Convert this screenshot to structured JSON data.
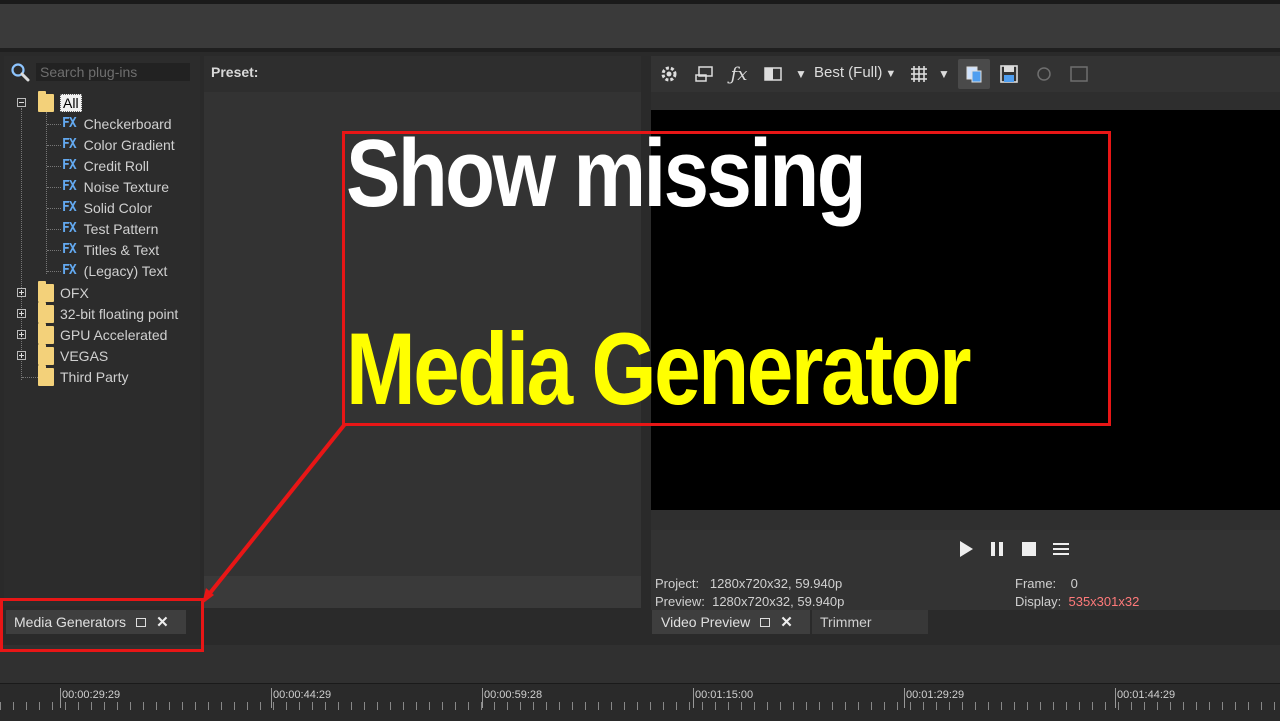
{
  "search": {
    "placeholder": "Search plug-ins"
  },
  "preset": {
    "label": "Preset:"
  },
  "tree": {
    "root": {
      "label": "All"
    },
    "fx_items": [
      {
        "label": "Checkerboard"
      },
      {
        "label": "Color Gradient"
      },
      {
        "label": "Credit Roll"
      },
      {
        "label": "Noise Texture"
      },
      {
        "label": "Solid Color"
      },
      {
        "label": "Test Pattern"
      },
      {
        "label": "Titles & Text"
      },
      {
        "label": "(Legacy) Text"
      }
    ],
    "folders": [
      {
        "label": "OFX"
      },
      {
        "label": "32-bit floating point"
      },
      {
        "label": "GPU Accelerated"
      },
      {
        "label": "VEGAS"
      },
      {
        "label": "Third Party"
      }
    ],
    "fx_badge": "FX"
  },
  "tabs": {
    "media_generators": "Media Generators",
    "video_preview": "Video Preview",
    "trimmer": "Trimmer"
  },
  "preview": {
    "quality": "Best (Full)",
    "project_label": "Project:",
    "project_value": "1280x720x32, 59.940p",
    "preview_label": "Preview:",
    "preview_value": "1280x720x32, 59.940p",
    "frame_label": "Frame:",
    "frame_value": "0",
    "display_label": "Display:",
    "display_value": "535x301x32"
  },
  "timeline": {
    "ruler_labels": [
      "00:00:29:29",
      "00:00:44:29",
      "00:00:59:28",
      "00:01:15:00",
      "00:01:29:29",
      "00:01:44:29"
    ]
  },
  "overlay": {
    "line1": "Show missing",
    "line2": "Media Generator"
  },
  "colors": {
    "highlight": "#e81616",
    "headline_white": "#ffffff",
    "headline_yellow": "#ffff00",
    "fx_badge": "#63a9f0",
    "folder": "#f3d17a",
    "display_value": "#ff7a7a"
  },
  "icons": {
    "toolbar": [
      "gear-icon",
      "preview-device-icon",
      "fx-icon",
      "split-screen-icon",
      "chevron-down-icon",
      "grid-icon",
      "copy-snapshot-icon",
      "save-snapshot-icon",
      "hdr-icon"
    ],
    "transport": [
      "play-icon",
      "pause-icon",
      "stop-icon",
      "menu-icon"
    ]
  }
}
